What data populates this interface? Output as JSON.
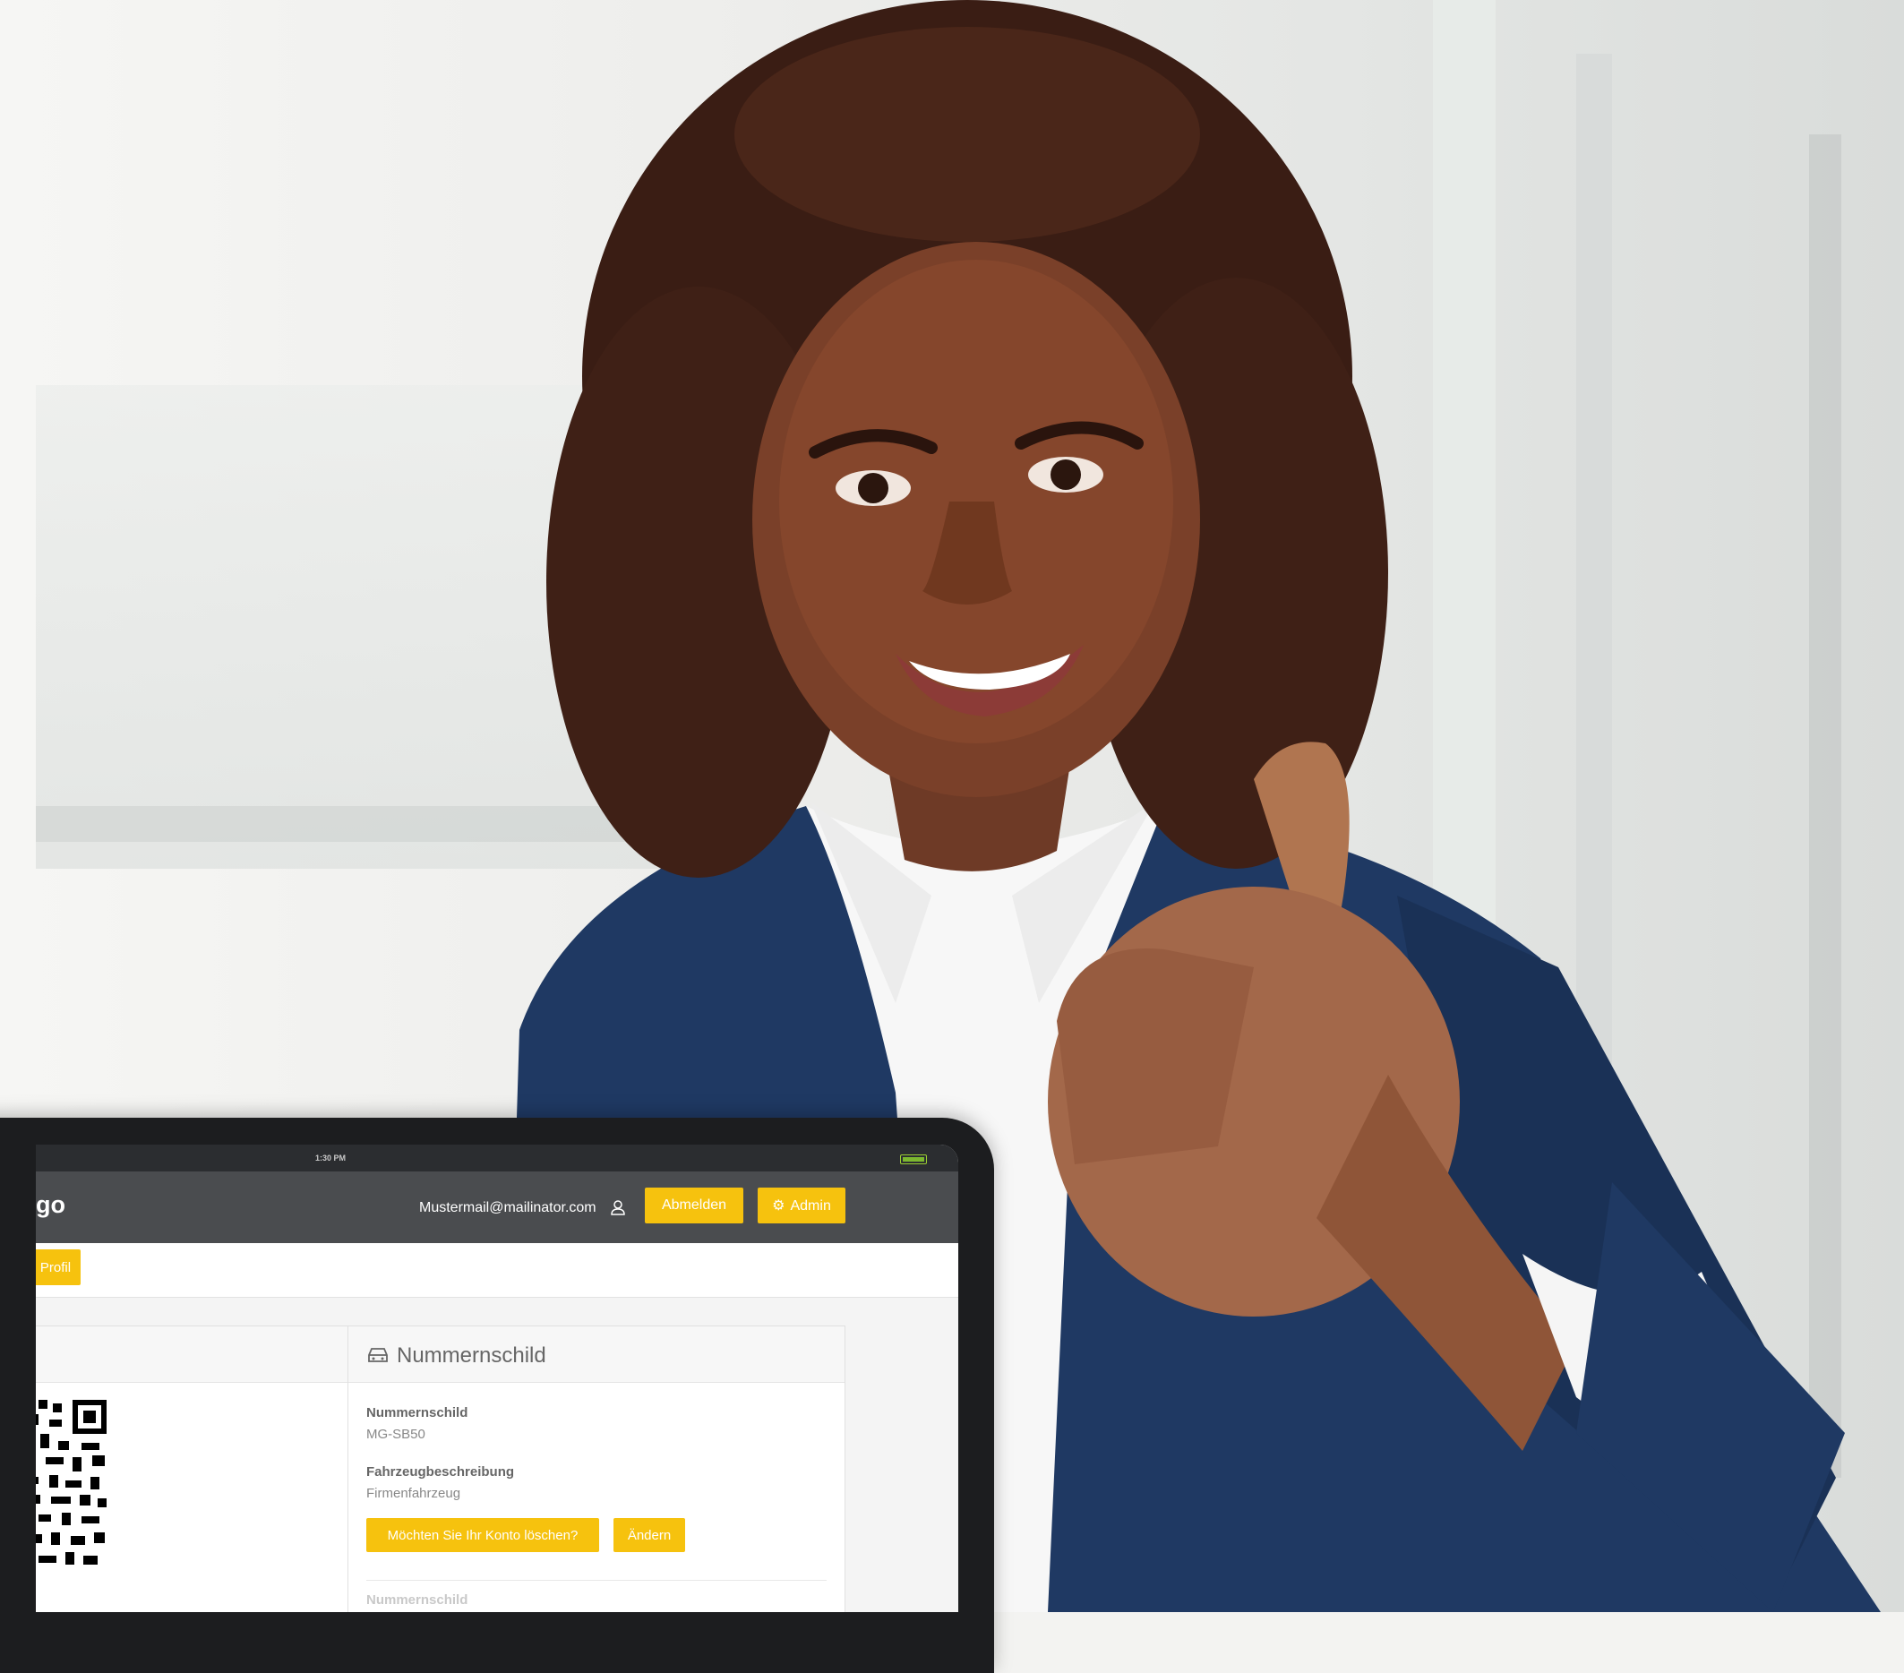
{
  "status_bar": {
    "time": "1:30 PM"
  },
  "header": {
    "brand": "go",
    "user_email": "Mustermail@mailinator.com",
    "logout_label": "Abmelden",
    "admin_label": "Admin"
  },
  "tabs": {
    "profile_label": "Profil"
  },
  "plate_card": {
    "title": "Nummernschild",
    "fields": [
      {
        "label": "Nummernschild",
        "value": "MG-SB50"
      },
      {
        "label": "Fahrzeugbeschreibung",
        "value": "Firmenfahrzeug"
      }
    ],
    "delete_label": "Möchten Sie Ihr Konto löschen?",
    "change_label": "Ändern",
    "next_label": "Nummernschild"
  },
  "colors": {
    "accent": "#f6c20e",
    "header_bg": "#4a4c4f",
    "statusbar_bg": "#2b2d30"
  }
}
